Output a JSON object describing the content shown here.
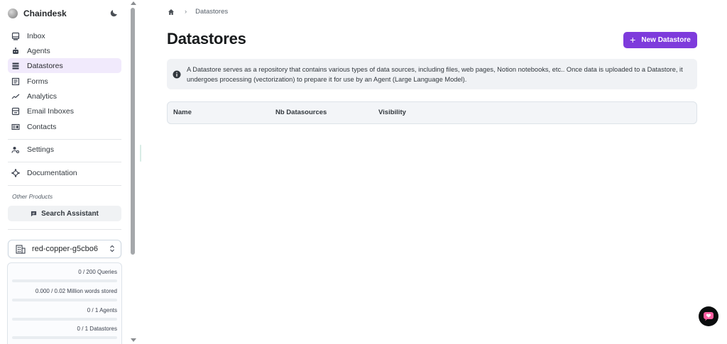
{
  "brand": {
    "name": "Chaindesk"
  },
  "sidebar": {
    "items": [
      {
        "label": "Inbox",
        "icon": "inbox-icon"
      },
      {
        "label": "Agents",
        "icon": "agent-icon"
      },
      {
        "label": "Datastores",
        "icon": "datastore-icon",
        "active": true
      },
      {
        "label": "Forms",
        "icon": "form-icon"
      },
      {
        "label": "Analytics",
        "icon": "analytics-icon"
      },
      {
        "label": "Email Inboxes",
        "icon": "email-inbox-icon"
      },
      {
        "label": "Contacts",
        "icon": "contacts-icon"
      }
    ],
    "settings": {
      "label": "Settings",
      "icon": "settings-icon"
    },
    "documentation": {
      "label": "Documentation",
      "icon": "documentation-icon"
    },
    "other_products_label": "Other Products",
    "search_assistant_label": "Search Assistant",
    "organization": "red-copper-g5cbo6",
    "usage": [
      {
        "label": "0 / 200 Queries",
        "fraction": 0
      },
      {
        "label": "0.000 / 0.02 Million words stored",
        "fraction": 0
      },
      {
        "label": "0 / 1 Agents",
        "fraction": 0
      },
      {
        "label": "0 / 1 Datastores",
        "fraction": 0
      }
    ]
  },
  "breadcrumb": {
    "current": "Datastores"
  },
  "page": {
    "title": "Datastores",
    "new_button_label": "New Datastore",
    "info_text": "A Datastore serves as a repository that contains various types of data sources, including files, web pages, Notion notebooks, etc.. Once data is uploaded to a Datastore, it undergoes processing (vectorization) to prepare it for use by an Agent (Large Language Model)."
  },
  "table": {
    "columns": [
      "Name",
      "Nb Datasources",
      "Visibility"
    ]
  },
  "colors": {
    "accent": "#7e3bdc",
    "active_bg": "#f1eafc"
  }
}
